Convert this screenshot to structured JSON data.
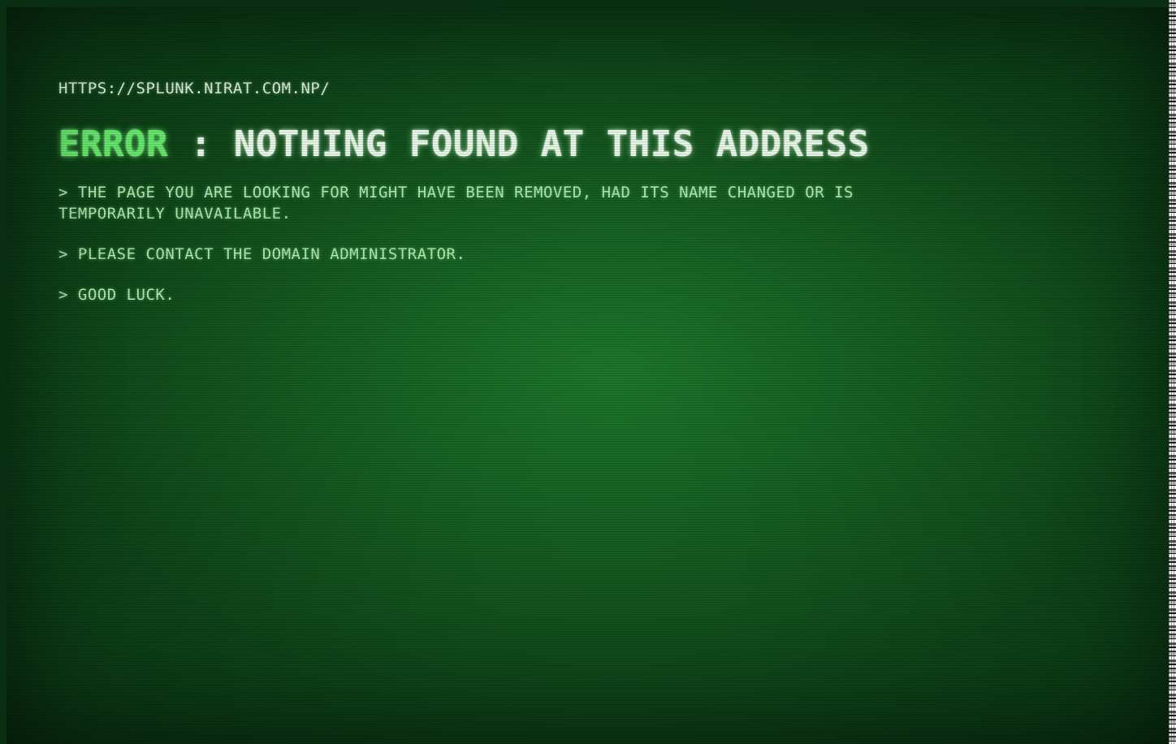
{
  "page": {
    "url_text": "HTTPS://SPLUNK.NIRAT.COM.NP/",
    "headline": {
      "error_word": "ERROR",
      "rest": " : NOTHING FOUND AT THIS ADDRESS"
    },
    "messages": [
      "> THE PAGE YOU ARE LOOKING FOR MIGHT HAVE BEEN REMOVED, HAD ITS NAME CHANGED OR IS TEMPORARILY UNAVAILABLE.",
      "> PLEASE CONTACT THE DOMAIN ADMINISTRATOR.",
      "> GOOD LUCK."
    ]
  },
  "colors": {
    "background": "#176324",
    "error_accent": "#6af06f",
    "headline_text": "#f0fff0",
    "body_text": "#b9f0bd"
  }
}
